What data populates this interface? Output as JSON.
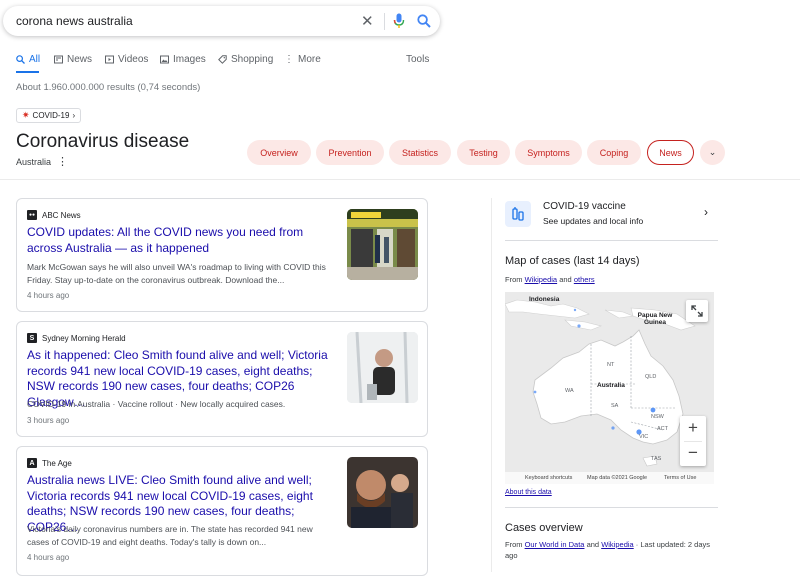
{
  "search": {
    "query": "corona news australia"
  },
  "tabs": [
    {
      "label": "All",
      "icon": "search-icon"
    },
    {
      "label": "News",
      "icon": "news-icon"
    },
    {
      "label": "Videos",
      "icon": "video-icon"
    },
    {
      "label": "Images",
      "icon": "image-icon"
    },
    {
      "label": "Shopping",
      "icon": "tag-icon"
    },
    {
      "label": "More",
      "icon": "more-vert-icon"
    }
  ],
  "tools_label": "Tools",
  "results_stats": "About 1.960.000.000 results (0,74 seconds)",
  "knowledge": {
    "chip_label": "COVID-19",
    "title": "Coronavirus disease",
    "subtitle": "Australia",
    "pills": [
      "Overview",
      "Prevention",
      "Statistics",
      "Testing",
      "Symptoms",
      "Coping",
      "News"
    ],
    "selected_pill": "News"
  },
  "news": [
    {
      "source": "ABC News",
      "source_icon": "ABC",
      "headline": "COVID updates: All the COVID news you need from across Australia — as it happened",
      "snippet": "Mark McGowan says he will also unveil WA's roadmap to living with COVID this Friday. Stay up-to-date on the coronavirus outbreak. Download the...",
      "time": "4 hours ago"
    },
    {
      "source": "Sydney Morning Herald",
      "source_icon": "S",
      "headline": "As it happened: Cleo Smith found alive and well; Victoria records 941 new local COVID-19 cases, eight deaths; NSW records 190 new cases, four deaths; COP26 Glasgow…",
      "snippet": "COVID-19 in Australia · Vaccine rollout · New locally acquired cases.",
      "time": "3 hours ago"
    },
    {
      "source": "The Age",
      "source_icon": "A",
      "headline": "Australia news LIVE: Cleo Smith found alive and well; Victoria records 941 new local COVID-19 cases, eight deaths; NSW records 190 new cases, four deaths; COP26…",
      "snippet": "Victoria's daily coronavirus numbers are in. The state has recorded 941 new cases of COVID-19 and eight deaths. Today's tally is down on...",
      "time": "4 hours ago"
    }
  ],
  "right_panel": {
    "vaccine_title": "COVID-19 vaccine",
    "vaccine_sub": "See updates and local info",
    "map_title": "Map of cases (last 14 days)",
    "map_from_prefix": "From",
    "map_from_link1": "Wikipedia",
    "map_from_and": "and",
    "map_from_link2": "others",
    "map_labels": {
      "indonesia": "Indonesia",
      "png": "Papua New Guinea",
      "australia": "Australia",
      "nt": "NT",
      "qld": "QLD",
      "wa": "WA",
      "sa": "SA",
      "nsw": "NSW",
      "act": "ACT",
      "vic": "VIC",
      "tas": "TAS"
    },
    "map_footer": [
      "Keyboard shortcuts",
      "Map data ©2021 Google",
      "Terms of Use"
    ],
    "about_data": "About this data",
    "cases_title": "Cases overview",
    "cases_from_prefix": "From",
    "cases_from_link1": "Our World in Data",
    "cases_from_and": "and",
    "cases_from_link2": "Wikipedia",
    "cases_updated": "· Last updated: 2 days ago"
  },
  "colors": {
    "accent": "#1a73e8",
    "link": "#1a0dab",
    "pill_bg": "#fce8e6",
    "pill_text": "#c5221f"
  }
}
